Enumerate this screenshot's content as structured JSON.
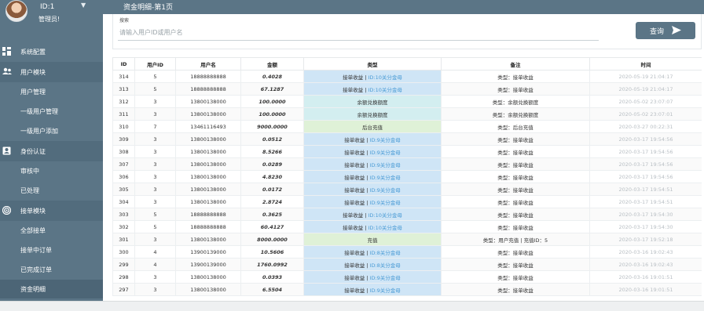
{
  "user": {
    "id_label": "ID:1",
    "role": "管理员!"
  },
  "header": {
    "title": "资金明细-第1页"
  },
  "sidebar": {
    "sections": [
      {
        "label": "系统配置",
        "icon": "dashboard-icon"
      },
      {
        "label": "用户模块",
        "icon": "users-icon",
        "items": [
          "用户管理",
          "一级用户管理",
          "一级用户添加"
        ]
      },
      {
        "label": "身份认证",
        "icon": "id-card-icon",
        "items": [
          "审核中",
          "已处理"
        ]
      },
      {
        "label": "接单模块",
        "icon": "target-icon",
        "items": [
          "全部接单",
          "接单中订单",
          "已完成订单",
          "资金明细"
        ]
      }
    ]
  },
  "search": {
    "label": "搜索",
    "placeholder": "请输入用户ID或用户名",
    "button": "查询"
  },
  "table": {
    "columns": [
      "ID",
      "用户ID",
      "用户名",
      "金额",
      "类型",
      "备注",
      "时间"
    ],
    "rows": [
      {
        "id": "314",
        "uid": "5",
        "name": "18888888888",
        "amount": "0.4028",
        "type": "接单收益",
        "link": "ID:10关分金母",
        "kind": "order",
        "note": "类型：接单收益",
        "time": "2020-05-19 21:04:17"
      },
      {
        "id": "313",
        "uid": "5",
        "name": "18888888888",
        "amount": "67.1287",
        "type": "接单收益",
        "link": "ID:10关分金母",
        "kind": "order",
        "note": "类型：接单收益",
        "time": "2020-05-19 21:04:17"
      },
      {
        "id": "312",
        "uid": "3",
        "name": "13800138000",
        "amount": "100.0000",
        "type": "余额兑换额度",
        "link": "",
        "kind": "balance",
        "note": "类型：余额兑换额度",
        "time": "2020-05-02 23:07:07"
      },
      {
        "id": "311",
        "uid": "3",
        "name": "13800138000",
        "amount": "100.0000",
        "type": "余额兑换额度",
        "link": "",
        "kind": "balance",
        "note": "类型：余额兑换额度",
        "time": "2020-05-02 23:07:01"
      },
      {
        "id": "310",
        "uid": "7",
        "name": "13461116493",
        "amount": "9000.0000",
        "type": "后台充值",
        "link": "",
        "kind": "recharge",
        "note": "类型：后台充值",
        "time": "2020-03-27 00:22:31"
      },
      {
        "id": "309",
        "uid": "3",
        "name": "13800138000",
        "amount": "0.0512",
        "type": "接单收益",
        "link": "ID:9关分金母",
        "kind": "order",
        "note": "类型：接单收益",
        "time": "2020-03-17 19:54:56"
      },
      {
        "id": "308",
        "uid": "3",
        "name": "13800138000",
        "amount": "8.5266",
        "type": "接单收益",
        "link": "ID:9关分金母",
        "kind": "order",
        "note": "类型：接单收益",
        "time": "2020-03-17 19:54:56"
      },
      {
        "id": "307",
        "uid": "3",
        "name": "13800138000",
        "amount": "0.0289",
        "type": "接单收益",
        "link": "ID:9关分金母",
        "kind": "order",
        "note": "类型：接单收益",
        "time": "2020-03-17 19:54:56"
      },
      {
        "id": "306",
        "uid": "3",
        "name": "13800138000",
        "amount": "4.8230",
        "type": "接单收益",
        "link": "ID:9关分金母",
        "kind": "order",
        "note": "类型：接单收益",
        "time": "2020-03-17 19:54:56"
      },
      {
        "id": "305",
        "uid": "3",
        "name": "13800138000",
        "amount": "0.0172",
        "type": "接单收益",
        "link": "ID:9关分金母",
        "kind": "order",
        "note": "类型：接单收益",
        "time": "2020-03-17 19:54:51"
      },
      {
        "id": "304",
        "uid": "3",
        "name": "13800138000",
        "amount": "2.8724",
        "type": "接单收益",
        "link": "ID:9关分金母",
        "kind": "order",
        "note": "类型：接单收益",
        "time": "2020-03-17 19:54:51"
      },
      {
        "id": "303",
        "uid": "5",
        "name": "18888888888",
        "amount": "0.3625",
        "type": "接单收益",
        "link": "ID:10关分金母",
        "kind": "order",
        "note": "类型：接单收益",
        "time": "2020-03-17 19:54:30"
      },
      {
        "id": "302",
        "uid": "5",
        "name": "18888888888",
        "amount": "60.4127",
        "type": "接单收益",
        "link": "ID:10关分金母",
        "kind": "order",
        "note": "类型：接单收益",
        "time": "2020-03-17 19:54:30"
      },
      {
        "id": "301",
        "uid": "3",
        "name": "13800138000",
        "amount": "8000.0000",
        "type": "充值",
        "link": "",
        "kind": "recharge",
        "note": "类型：用户充值 | 充值ID：5",
        "time": "2020-03-17 19:52:18"
      },
      {
        "id": "300",
        "uid": "4",
        "name": "13900139000",
        "amount": "10.5606",
        "type": "接单收益",
        "link": "ID:8关分金母",
        "kind": "order",
        "note": "类型：接单收益",
        "time": "2020-03-16 19:02:43"
      },
      {
        "id": "299",
        "uid": "4",
        "name": "13900139000",
        "amount": "1760.0992",
        "type": "接单收益",
        "link": "ID:8关分金母",
        "kind": "order",
        "note": "类型：接单收益",
        "time": "2020-03-16 19:02:43"
      },
      {
        "id": "298",
        "uid": "3",
        "name": "13800138000",
        "amount": "0.0393",
        "type": "接单收益",
        "link": "ID:9关分金母",
        "kind": "order",
        "note": "类型：接单收益",
        "time": "2020-03-16 19:01:51"
      },
      {
        "id": "297",
        "uid": "3",
        "name": "13800138000",
        "amount": "6.5504",
        "type": "接单收益",
        "link": "ID:9关分金母",
        "kind": "order",
        "note": "类型：接单收益",
        "time": "2020-03-16 19:01:51"
      }
    ]
  }
}
